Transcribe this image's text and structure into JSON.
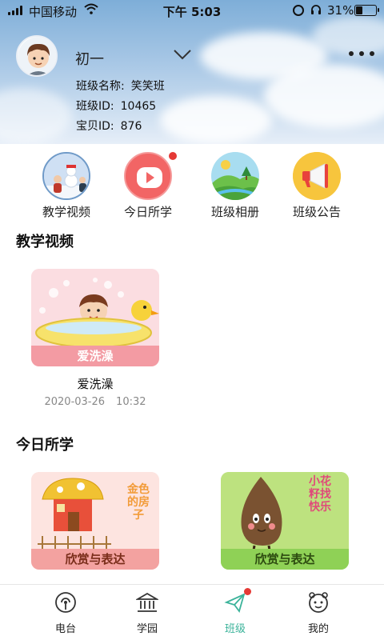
{
  "status_bar": {
    "carrier": "中国移动",
    "time": "下午 5:03",
    "battery": "31%"
  },
  "header": {
    "class_name": "初一",
    "info": [
      {
        "label": "班级名称:",
        "value": "笑笑班"
      },
      {
        "label": "班级ID:",
        "value": "10465"
      },
      {
        "label": "宝贝ID:",
        "value": "876"
      }
    ]
  },
  "categories": [
    {
      "label": "教学视频",
      "icon": "teaching-video-icon",
      "badge": false
    },
    {
      "label": "今日所学",
      "icon": "play-icon",
      "badge": true
    },
    {
      "label": "班级相册",
      "icon": "photo-album-icon",
      "badge": false
    },
    {
      "label": "班级公告",
      "icon": "megaphone-icon",
      "badge": false
    }
  ],
  "sections": {
    "videos": {
      "title": "教学视频",
      "items": [
        {
          "title": "爱洗澡",
          "banner": "爱洗澡",
          "date": "2020-03-26",
          "time": "10:32"
        }
      ]
    },
    "today": {
      "title": "今日所学",
      "items": [
        {
          "banner": "欣赏与表达",
          "art_text": "金色的房子"
        },
        {
          "banner": "欣赏与表达",
          "art_text": "小花籽找快乐"
        }
      ]
    }
  },
  "tabs": [
    {
      "label": "电台",
      "icon": "radio-icon",
      "active": false
    },
    {
      "label": "学园",
      "icon": "school-icon",
      "active": false
    },
    {
      "label": "班级",
      "icon": "paper-plane-icon",
      "active": true
    },
    {
      "label": "我的",
      "icon": "profile-face-icon",
      "active": false
    }
  ],
  "colors": {
    "accent": "#3bb39a",
    "badge": "#e53935",
    "sky": "#a9c8e6"
  }
}
